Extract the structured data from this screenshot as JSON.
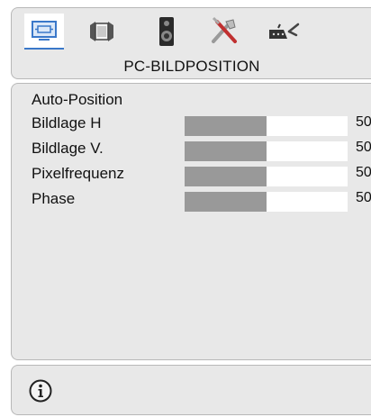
{
  "header": {
    "tabs": [
      {
        "name": "pc-tab",
        "icon": "monitor-icon",
        "active": true
      },
      {
        "name": "screen-tab",
        "icon": "screen-frame-icon",
        "active": false
      },
      {
        "name": "audio-tab",
        "icon": "speaker-icon",
        "active": false
      },
      {
        "name": "tools-tab",
        "icon": "tools-icon",
        "active": false
      },
      {
        "name": "source-tab",
        "icon": "connector-icon",
        "active": false
      }
    ],
    "title": "PC-BILDPOSITION"
  },
  "menu": {
    "auto_position": "Auto-Position",
    "items": [
      {
        "label": "Bildlage H",
        "value": "50",
        "level": 0.5
      },
      {
        "label": "Bildlage V.",
        "value": "50",
        "level": 0.5
      },
      {
        "label": "Pixelfrequenz",
        "value": "50",
        "level": 0.5
      },
      {
        "label": "Phase",
        "value": "50",
        "level": 0.5
      }
    ]
  },
  "footer": {
    "icon": "info-icon"
  },
  "colors": {
    "accent": "#3a78c9",
    "bar_fill": "#999999",
    "panel": "#e8e8e8"
  }
}
